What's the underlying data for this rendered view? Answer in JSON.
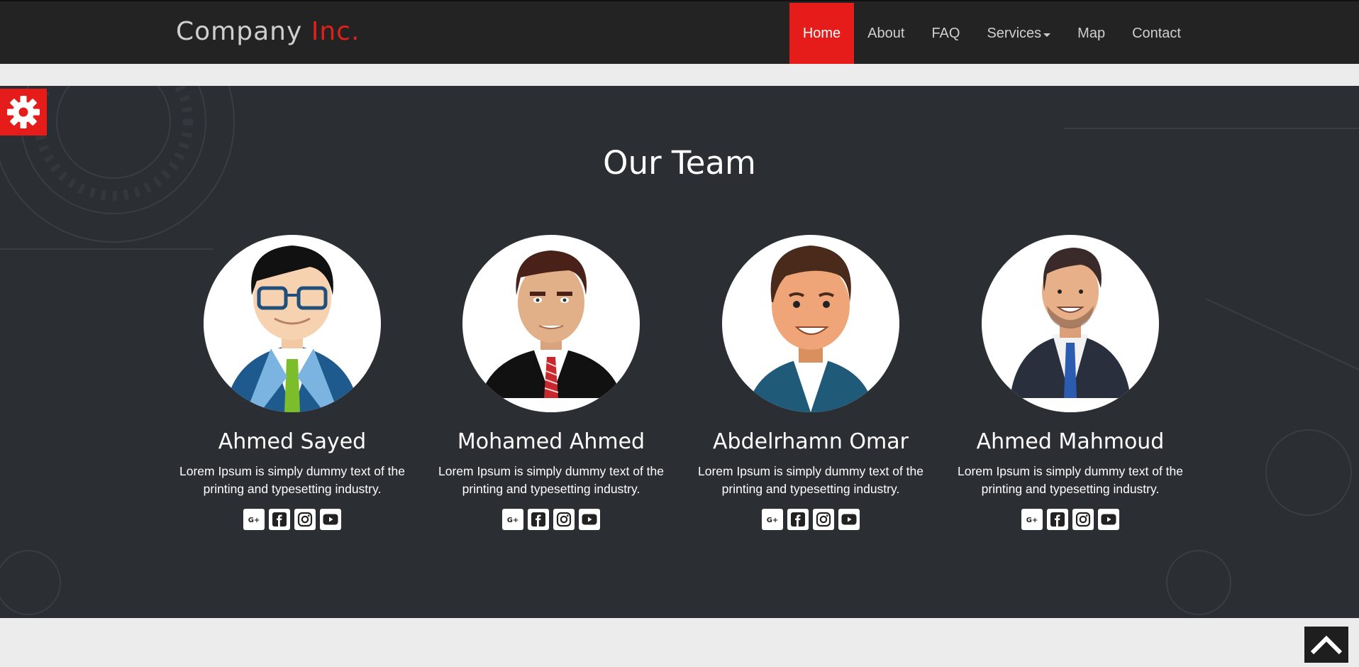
{
  "brand": {
    "name": "Company",
    "accent": "Inc."
  },
  "nav": {
    "items": [
      {
        "label": "Home",
        "active": true
      },
      {
        "label": "About"
      },
      {
        "label": "FAQ"
      },
      {
        "label": "Services",
        "dropdown": true
      },
      {
        "label": "Map"
      },
      {
        "label": "Contact"
      }
    ]
  },
  "team": {
    "title": "Our Team",
    "members": [
      {
        "name": "Ahmed Sayed",
        "description": "Lorem Ipsum is simply dummy text of the printing and typesetting industry."
      },
      {
        "name": "Mohamed Ahmed",
        "description": "Lorem Ipsum is simply dummy text of the printing and typesetting industry."
      },
      {
        "name": "Abdelrhamn Omar",
        "description": "Lorem Ipsum is simply dummy text of the printing and typesetting industry."
      },
      {
        "name": "Ahmed Mahmoud",
        "description": "Lorem Ipsum is simply dummy text of the printing and typesetting industry."
      }
    ],
    "social_icons": [
      "google-plus-icon",
      "facebook-icon",
      "instagram-icon",
      "youtube-icon"
    ]
  },
  "floating": {
    "settings_icon": "gear-icon",
    "scroll_top_icon": "chevron-up-icon"
  },
  "colors": {
    "accent": "#e51c19",
    "navbar_bg": "#232323",
    "section_bg": "#2b2e33",
    "page_bg": "#ececec"
  }
}
